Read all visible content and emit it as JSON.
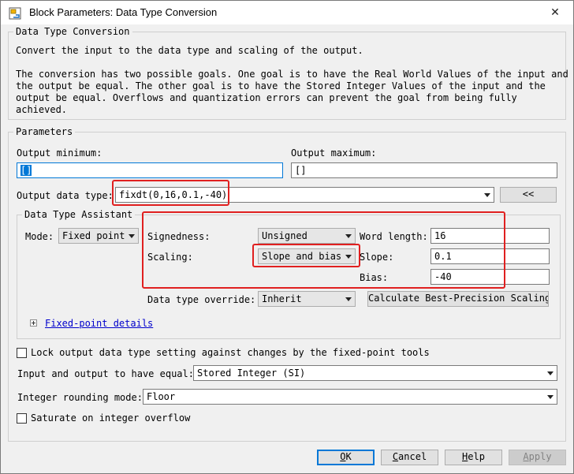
{
  "window": {
    "title": "Block Parameters: Data Type Conversion",
    "close_glyph": "✕"
  },
  "block_group": {
    "label": "Data Type Conversion",
    "description": [
      "Convert the input to the data type and scaling of the output.",
      "",
      "The conversion has two possible goals. One goal is to have the Real World Values of the input and",
      "the output be equal.  The other goal is to have the Stored Integer Values of the input and the",
      "output be equal.  Overflows and quantization errors can prevent the goal from being fully",
      "achieved."
    ]
  },
  "parameters": {
    "label": "Parameters",
    "output_minimum": {
      "label": "Output minimum:",
      "value": "[]"
    },
    "output_maximum": {
      "label": "Output maximum:",
      "value": "[]"
    },
    "output_data_type": {
      "label": "Output data type:",
      "value": "fixdt(0,16,0.1,-40)",
      "toggle_button": "<<"
    }
  },
  "assistant": {
    "label": "Data Type Assistant",
    "mode_label": "Mode:",
    "mode_value": "Fixed point",
    "signedness_label": "Signedness:",
    "signedness_value": "Unsigned",
    "scaling_label": "Scaling:",
    "scaling_value": "Slope and bias",
    "word_length_label": "Word length:",
    "word_length_value": "16",
    "slope_label": "Slope:",
    "slope_value": "0.1",
    "bias_label": "Bias:",
    "bias_value": "-40",
    "override_label": "Data type override:",
    "override_value": "Inherit",
    "calc_button": "Calculate Best-Precision Scaling",
    "fixed_point_details": "Fixed-point details"
  },
  "options": {
    "lock_label": "Lock output data type setting against changes by the fixed-point tools",
    "equal_label": "Input and output to have equal:",
    "equal_value": "Stored Integer (SI)",
    "rounding_label": "Integer rounding mode:",
    "rounding_value": "Floor",
    "saturate_label": "Saturate on integer overflow"
  },
  "buttons": {
    "ok": {
      "key": "O",
      "rest": "K"
    },
    "cancel": {
      "key": "C",
      "rest": "ancel"
    },
    "help": {
      "key": "H",
      "rest": "elp"
    },
    "apply": {
      "key": "A",
      "rest": "pply"
    }
  },
  "colors": {
    "highlight_box": "#e02020",
    "focus": "#0078d7",
    "link": "#0000cc"
  }
}
